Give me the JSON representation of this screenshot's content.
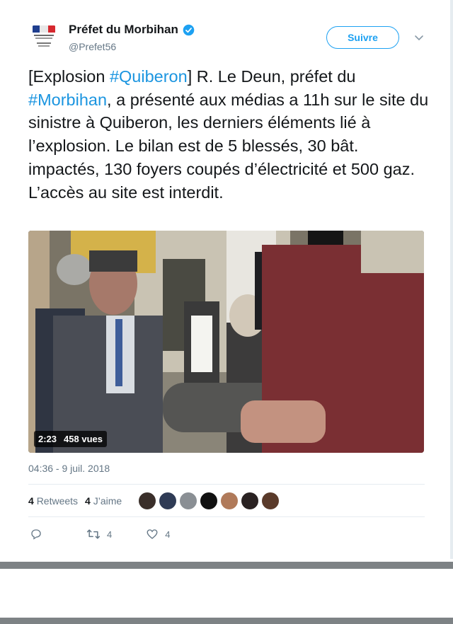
{
  "account": {
    "name": "Préfet du Morbihan",
    "handle": "@Prefet56",
    "avatar_caption": "PRÉFET DU MORBIHAN"
  },
  "follow_button": "Suivre",
  "tweet": {
    "segments": [
      {
        "text": "[Explosion ",
        "type": "text"
      },
      {
        "text": "#Quiberon",
        "type": "hashtag"
      },
      {
        "text": "] R. Le Deun, préfet du ",
        "type": "text"
      },
      {
        "text": "#Morbihan",
        "type": "hashtag"
      },
      {
        "text": ", a présenté aux médias a 11h sur le site du sinistre à Quiberon, les derniers éléments lié à l’explosion. Le bilan est de 5 blessés, 30 bât. impactés, 130 foyers coupés d’électricité et 500 gaz. L’accès au site est interdit.",
        "type": "text"
      }
    ]
  },
  "video": {
    "duration": "2:23",
    "views": "458 vues"
  },
  "timestamp": "04:36 - 9 juil. 2018",
  "stats": {
    "retweets_count": "4",
    "retweets_label": "Retweets",
    "likes_count": "4",
    "likes_label": "J’aime"
  },
  "actions": {
    "retweet_count": "4",
    "like_count": "4"
  },
  "colors": {
    "accent": "#1da1f2",
    "hashtag": "#1b95e0",
    "muted": "#657786"
  }
}
